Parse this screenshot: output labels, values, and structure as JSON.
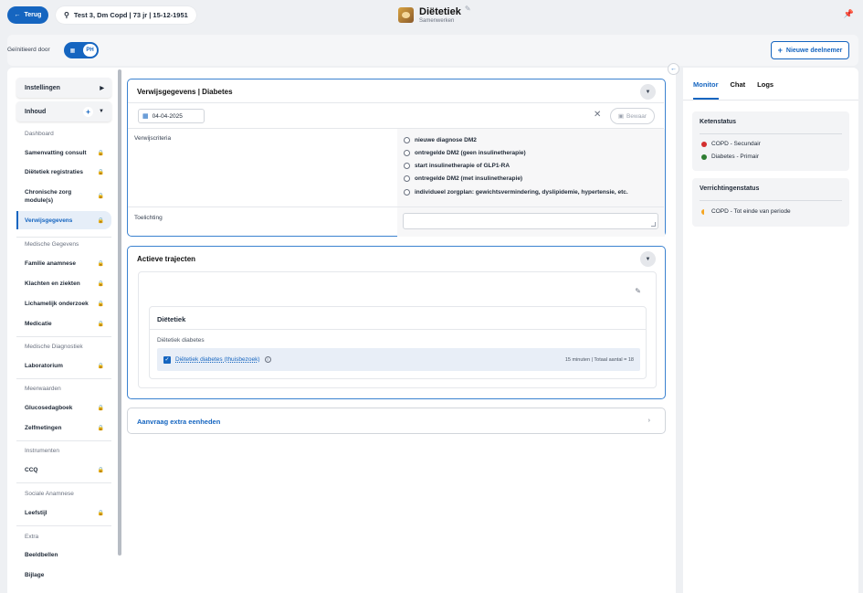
{
  "topbar": {
    "back_label": "Terug",
    "patient": "Test 3, Dm Copd | 73 jr | 15-12-1951",
    "app_title": "Diëtetiek",
    "app_subtitle": "Samenwerken"
  },
  "subbar": {
    "initiated_label": "Geïnitieerd door",
    "toggle_right": "PH",
    "new_participant_label": "Nieuwe deelnemer"
  },
  "sidebar": {
    "settings_label": "Instellingen",
    "content_label": "Inhoud",
    "groups": {
      "dashboard": "Dashboard",
      "medical_data": "Medische Gegevens",
      "medical_diagnostics": "Medische Diagnostiek",
      "measurements": "Meerwaarden",
      "instruments": "Instrumenten",
      "social_anamnesis": "Sociale Anamnese",
      "extra": "Extra"
    },
    "items": {
      "summary_consult": "Samenvatting consult",
      "dietetics_registration": "Diëtetiek registraties",
      "chronic_care": "Chronische zorg module(s)",
      "referral_data": "Verwijsgegevens",
      "family_anamnesis": "Familie anamnese",
      "complaints": "Klachten en ziekten",
      "physical_exam": "Lichamelijk onderzoek",
      "medication": "Medicatie",
      "laboratory": "Laboratorium",
      "glucose_diary": "Glucosedagboek",
      "self_measurements": "Zelfmetingen",
      "ccq": "CCQ",
      "lifestyle": "Leefstijl",
      "video_call": "Beeldbellen",
      "attachment": "Bijlage"
    }
  },
  "referral_card": {
    "title": "Verwijsgegevens | Diabetes",
    "date_value": "04-04-2025",
    "save_label": "Bewaar",
    "criteria_label": "Verwijscriteria",
    "criteria": [
      "nieuwe diagnose DM2",
      "ontregelde DM2 (geen insulinetherapie)",
      "start insulinetherapie of GLP1-RA",
      "ontregelde DM2 (met insulinetherapie)",
      "individueel zorgplan: gewichtsvermindering, dyslipidemie, hypertensie, etc."
    ],
    "explanation_label": "Toelichting",
    "explanation_value": ""
  },
  "active_card": {
    "title": "Actieve trajecten",
    "dietetics_title": "Diëtetiek",
    "dietetics_sub": "Diëtetiek diabetes",
    "row_link": "Diëtetiek diabetes (thuisbezoek)",
    "row_meta": "15 minuten | Totaal aantal = 18"
  },
  "extra_card": {
    "title": "Aanvraag extra eenheden"
  },
  "right_panel": {
    "tabs": [
      "Monitor",
      "Chat",
      "Logs"
    ],
    "chain_status_title": "Ketenstatus",
    "chain_status": [
      {
        "label": "COPD - Secundair",
        "color": "#d32f2f"
      },
      {
        "label": "Diabetes - Primair",
        "color": "#2e7d32"
      }
    ],
    "service_status_title": "Verrichtingenstatus",
    "service_status": [
      {
        "label": "COPD - Tot einde van periode",
        "color": "#f5a623"
      }
    ]
  },
  "colors": {
    "accent": "#1565c0"
  }
}
